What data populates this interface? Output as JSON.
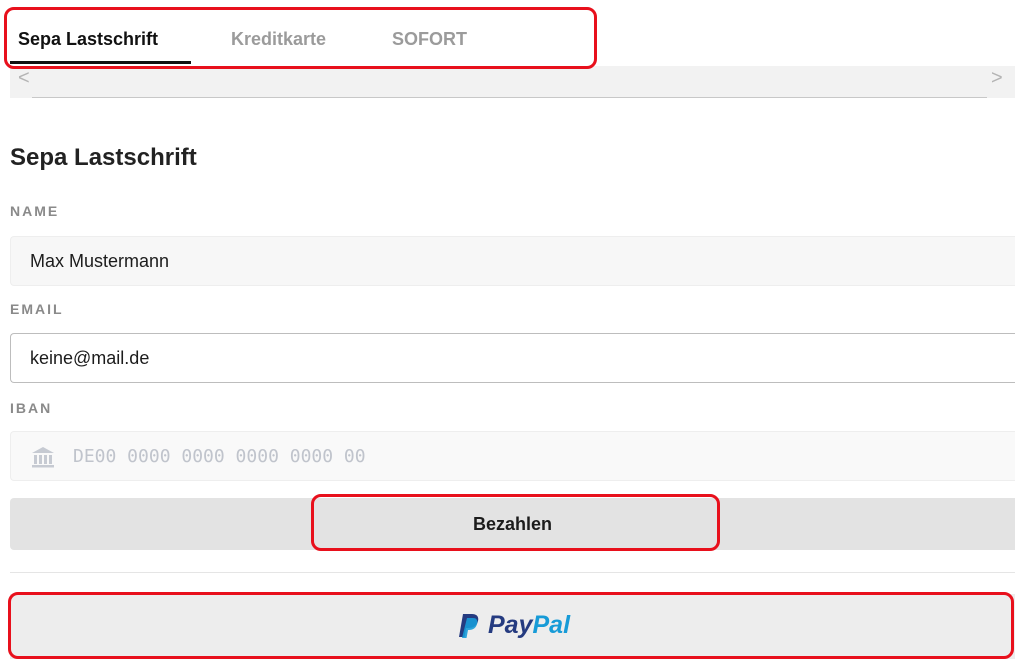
{
  "tabs": [
    {
      "label": "Sepa Lastschrift",
      "active": true
    },
    {
      "label": "Kreditkarte",
      "active": false
    },
    {
      "label": "SOFORT",
      "active": false
    }
  ],
  "scroll": {
    "left_arrow": "<",
    "right_arrow": ">"
  },
  "form": {
    "title": "Sepa Lastschrift",
    "name_label": "NAME",
    "name_value": "Max Mustermann",
    "email_label": "EMAIL",
    "email_value": "keine@mail.de",
    "iban_label": "IBAN",
    "iban_placeholder": "DE00 0000 0000 0000 0000 00",
    "iban_icon": "bank-icon"
  },
  "pay_button": {
    "label": "Bezahlen"
  },
  "paypal": {
    "label_a": "Pay",
    "label_b": "Pal",
    "icon": "paypal-p-icon"
  },
  "colors": {
    "highlight": "#e8101c",
    "active_tab": "#111111",
    "inactive_tab": "#9b9b9b",
    "paypal_dark": "#253b80",
    "paypal_light": "#179bd7"
  }
}
